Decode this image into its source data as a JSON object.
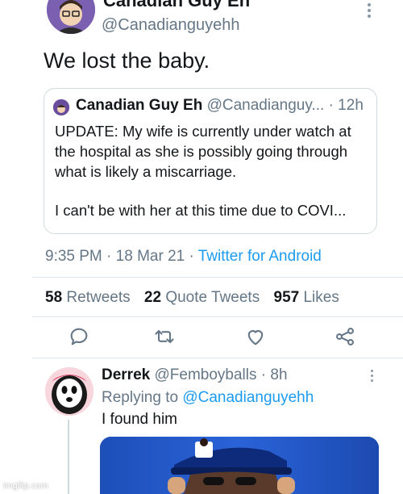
{
  "tweet": {
    "author_name": "Canadian Guy Eh",
    "author_handle": "@Canadianguyehh",
    "text": "We lost the baby."
  },
  "quoted_tweet": {
    "author_name": "Canadian Guy Eh",
    "author_handle": "@Canadianguy...",
    "time": "· 12h",
    "text": "UPDATE: My wife is currently under watch at the hospital as she is possibly going through what is likely a miscarriage.",
    "text2": "I can't be with her at this time due to COVI..."
  },
  "meta": {
    "time": "9:35 PM",
    "date": "18 Mar 21",
    "source": "Twitter for Android"
  },
  "stats": {
    "retweets_count": "58",
    "retweets_label": "Retweets",
    "quotes_count": "22",
    "quotes_label": "Quote Tweets",
    "likes_count": "957",
    "likes_label": "Likes"
  },
  "actions": [
    "reply-icon",
    "retweet-icon",
    "like-icon",
    "share-icon"
  ],
  "reply": {
    "author_name": "Derrek",
    "author_handle": "@Femboyballs",
    "time": "· 8h",
    "replying_prefix": "Replying to",
    "replying_to": "@Canadianguyehh",
    "text": "I found him"
  },
  "watermark": "imgflip.com",
  "colors": {
    "link": "#1d9bf0",
    "secondary_text": "#657786",
    "primary_text": "#14171a",
    "border": "#cfd9de"
  }
}
